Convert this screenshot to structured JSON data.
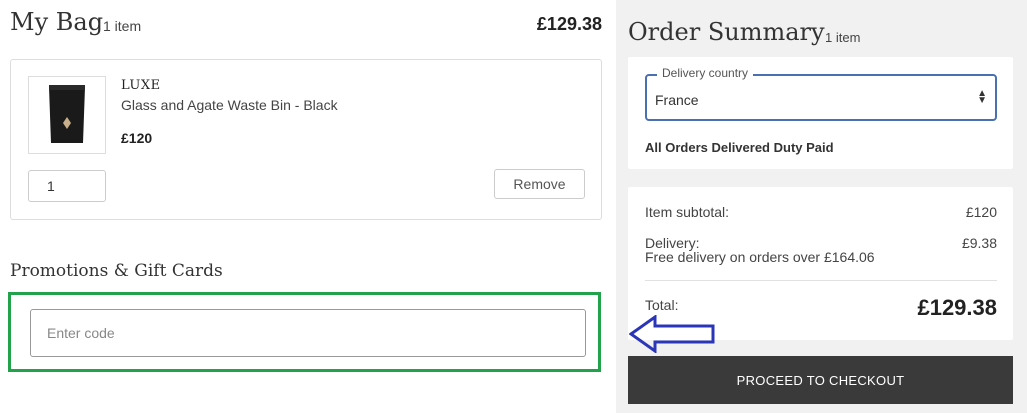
{
  "bag": {
    "title": "My Bag",
    "count": "1 item",
    "total": "£129.38",
    "items": [
      {
        "brand": "LUXE",
        "name": "Glass and Agate Waste Bin - Black",
        "price": "£120",
        "quantity": "1",
        "remove_label": "Remove",
        "image_icon": "waste-bin-product-image"
      }
    ]
  },
  "promo": {
    "title": "Promotions & Gift Cards",
    "placeholder": "Enter code"
  },
  "summary": {
    "title": "Order Summary",
    "count": "1 item",
    "delivery_country_label": "Delivery country",
    "delivery_country_value": "France",
    "duty_text": "All Orders Delivered Duty Paid",
    "subtotal_label": "Item subtotal:",
    "subtotal_value": "£120",
    "delivery_label": "Delivery:",
    "delivery_value": "£9.38",
    "free_delivery_note": "Free delivery on orders over £164.06",
    "total_label": "Total:",
    "total_value": "£129.38",
    "checkout_label": "PROCEED TO CHECKOUT"
  },
  "colors": {
    "highlight_green": "#22a24a",
    "annotation_blue": "#2b35b8",
    "select_border": "#4b6fb3",
    "checkout_bg": "#3a3a3a",
    "panel_bg": "#f1f1f1"
  }
}
